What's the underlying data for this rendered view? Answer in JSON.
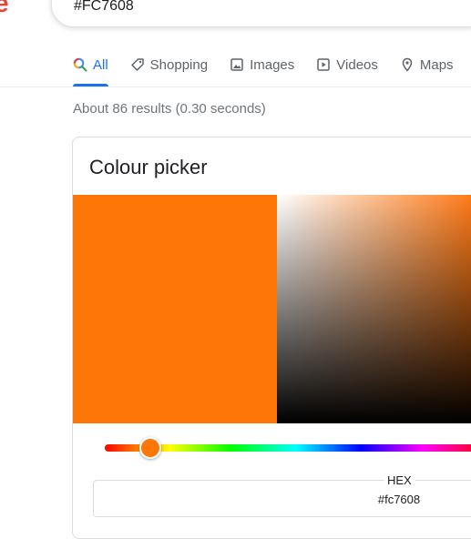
{
  "search": {
    "query": "#FC7608"
  },
  "tabs": [
    {
      "label": "All",
      "icon": "search-icon",
      "active": true
    },
    {
      "label": "Shopping",
      "icon": "tag-icon"
    },
    {
      "label": "Images",
      "icon": "image-icon"
    },
    {
      "label": "Videos",
      "icon": "play-icon"
    },
    {
      "label": "Maps",
      "icon": "map-pin-icon"
    }
  ],
  "result_stats": "About 86 results (0.30 seconds)",
  "color_picker": {
    "title": "Colour picker",
    "selected_color": "#fc7608",
    "hex_label": "HEX",
    "hex_value": "#fc7608"
  },
  "colors": {
    "accent": "#1a73e8",
    "tab_inactive": "#5f6368",
    "logo_red": "#ea4335"
  }
}
